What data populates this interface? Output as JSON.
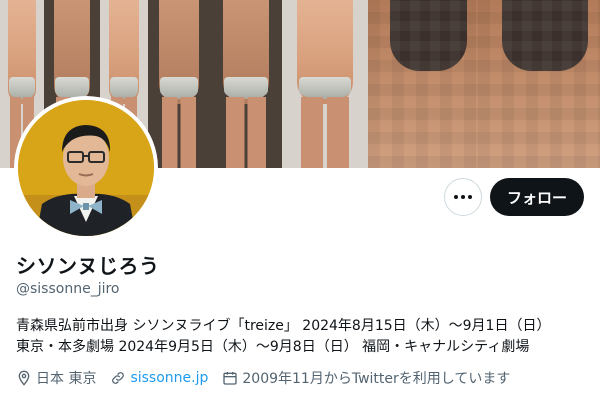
{
  "profile": {
    "display_name": "シソンヌじろう",
    "handle": "@sissonne_jiro",
    "bio_line1": "青森県弘前市出身 シソンヌライブ「treize」 2024年8月15日（木）～9月1日（日）",
    "bio_line2": "東京・本多劇場 2024年9月5日（木）～9月8日（日） 福岡・キャナルシティ劇場",
    "location": "日本 東京",
    "website": "sissonne.jp",
    "joined": "2009年11月からTwitterを利用しています"
  },
  "actions": {
    "follow_label": "フォロー",
    "more_icon": "more-dots-icon"
  },
  "icons": {
    "location": "location-pin-icon",
    "website": "link-icon",
    "joined": "calendar-icon"
  },
  "colors": {
    "text": "#0f1419",
    "secondary": "#536471",
    "link": "#1d9bf0",
    "follow_bg": "#0f1419",
    "avatar_bg": "#d8a418"
  }
}
